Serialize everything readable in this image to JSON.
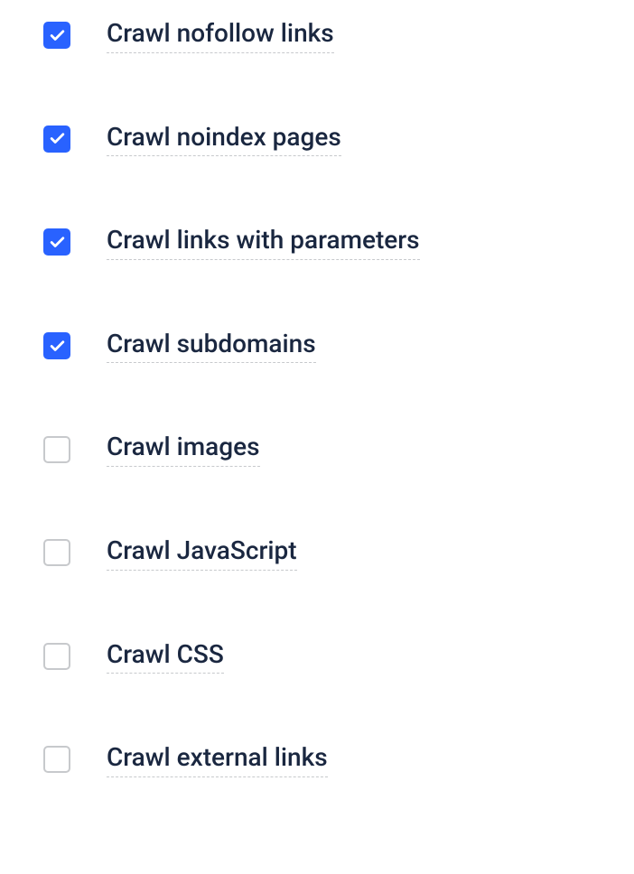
{
  "options": [
    {
      "label": "Crawl nofollow links",
      "checked": true
    },
    {
      "label": "Crawl noindex pages",
      "checked": true
    },
    {
      "label": "Crawl links with parameters",
      "checked": true
    },
    {
      "label": "Crawl subdomains",
      "checked": true
    },
    {
      "label": "Crawl images",
      "checked": false
    },
    {
      "label": "Crawl JavaScript",
      "checked": false
    },
    {
      "label": "Crawl CSS",
      "checked": false
    },
    {
      "label": "Crawl external links",
      "checked": false
    }
  ]
}
